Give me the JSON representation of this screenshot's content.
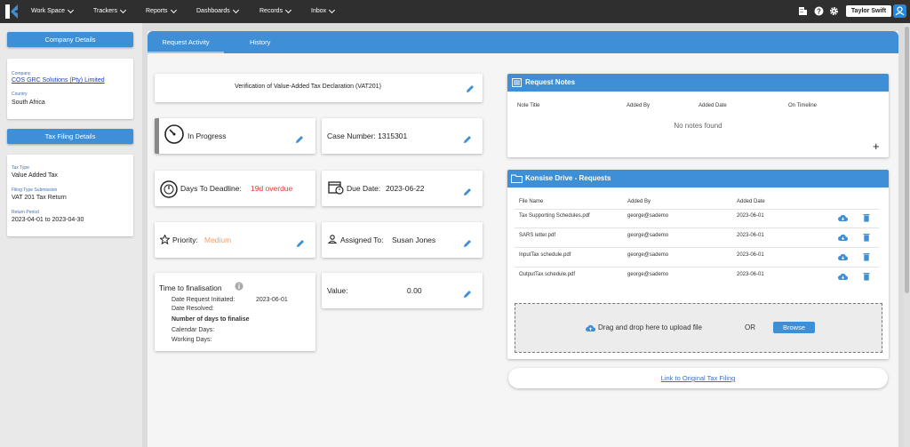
{
  "nav": {
    "items": [
      "Work Space",
      "Trackers",
      "Reports",
      "Dashboards",
      "Records",
      "Inbox"
    ],
    "user_name": "Taylor Swift"
  },
  "sidebar": {
    "company_header": "Company Details",
    "company_label": "Company",
    "company_value": "COS GRC Solutions (Pty) Limited",
    "country_label": "Country",
    "country_value": "South Africa",
    "tax_header": "Tax Filing Details",
    "tax_type_label": "Tax Type",
    "tax_type_value": "Value Added Tax",
    "filing_type_label": "Filing Type Submission",
    "filing_type_value": "VAT 201 Tax Return",
    "return_period_label": "Return Period",
    "return_period_value": "2023-04-01 to 2023-04-30"
  },
  "tabs": {
    "activity": "Request Activity",
    "history": "History"
  },
  "request": {
    "title": "Verification of Value-Added Tax Declaration (VAT201)",
    "status": "In Progress",
    "case_number": "Case Number: 1315301",
    "days_label": "Days To Deadline:",
    "days_value": "19d overdue",
    "due_label": "Due Date:",
    "due_value": "2023-06-22",
    "priority_label": "Priority:",
    "priority_value": "Medium",
    "assigned_label": "Assigned To:",
    "assigned_value": "Susan Jones",
    "value_label": "Value:",
    "value_amount": "0.00"
  },
  "finalisation": {
    "title": "Time to finalisation",
    "initiated_label": "Date Request Initiated:",
    "initiated_value": "2023-06-01",
    "resolved_label": "Date Resolved:",
    "days_label": "Number of days to finalise",
    "calendar_label": "Calendar Days:",
    "working_label": "Working Days:"
  },
  "notes": {
    "title": "Request Notes",
    "columns": [
      "Note Title",
      "Added By",
      "Added Date",
      "On Timeline"
    ],
    "empty": "No notes found",
    "add": "+"
  },
  "drive": {
    "title": "Konsise Drive - Requests",
    "columns": [
      "File Name",
      "Added By",
      "Added Date"
    ],
    "files": [
      {
        "name": "Tax Supporting Schedules.pdf",
        "by": "george@sademo",
        "date": "2023-06-01"
      },
      {
        "name": "SARS letter.pdf",
        "by": "george@sademo",
        "date": "2023-06-01"
      },
      {
        "name": "InputTax schedule.pdf",
        "by": "george@sademo",
        "date": "2023-06-01"
      },
      {
        "name": "OutputTax schedule.pdf",
        "by": "george@sademo",
        "date": "2023-06-01"
      }
    ],
    "drop_text": "Drag and drop here to upload file",
    "or_text": "OR",
    "browse": "Browse"
  },
  "link_original": "Link to Original Tax Filing",
  "colors": {
    "accent": "#3f8fd6",
    "topbar": "#2f2f2f",
    "overdue": "#e53935",
    "medium": "#f0a070"
  }
}
